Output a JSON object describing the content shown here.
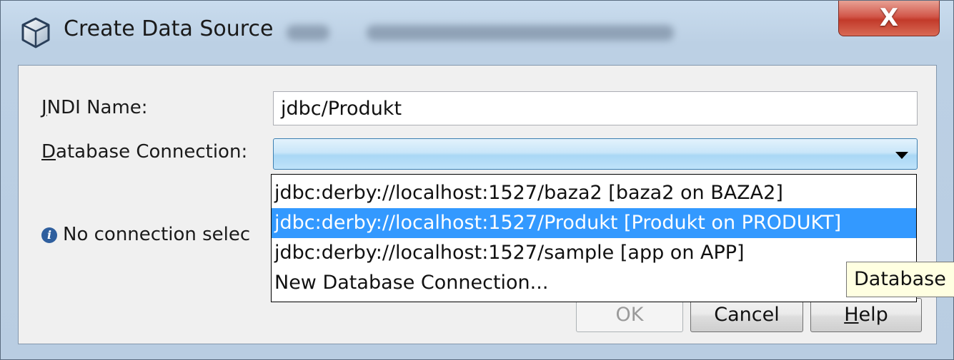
{
  "window": {
    "title": "Create Data Source",
    "close_glyph": "X",
    "title_icon": "cube-icon"
  },
  "form": {
    "jndi_label_mnemonic": "J",
    "jndi_label_rest": "NDI Name:",
    "jndi_value": "jdbc/Produkt",
    "db_label_mnemonic": "D",
    "db_label_rest": "atabase Connection:",
    "db_selected_value": ""
  },
  "status": {
    "icon": "info-icon",
    "text": "No connection selec"
  },
  "dropdown": {
    "items": [
      {
        "label": "jdbc:derby://localhost:1527/baza2 [baza2 on BAZA2]",
        "selected": false
      },
      {
        "label": "jdbc:derby://localhost:1527/Produkt [Produkt on PRODUKT]",
        "selected": true
      },
      {
        "label": "jdbc:derby://localhost:1527/sample [app on APP]",
        "selected": false
      },
      {
        "label": "New Database Connection...",
        "selected": false
      }
    ]
  },
  "buttons": {
    "ok_label": "OK",
    "cancel_label": "Cancel",
    "help_mnemonic": "H",
    "help_rest": "elp"
  },
  "tooltip": {
    "text": "Database"
  },
  "colors": {
    "selection": "#3399ff",
    "close_button": "#c23a2a",
    "combo_border": "#3c7fb1"
  }
}
